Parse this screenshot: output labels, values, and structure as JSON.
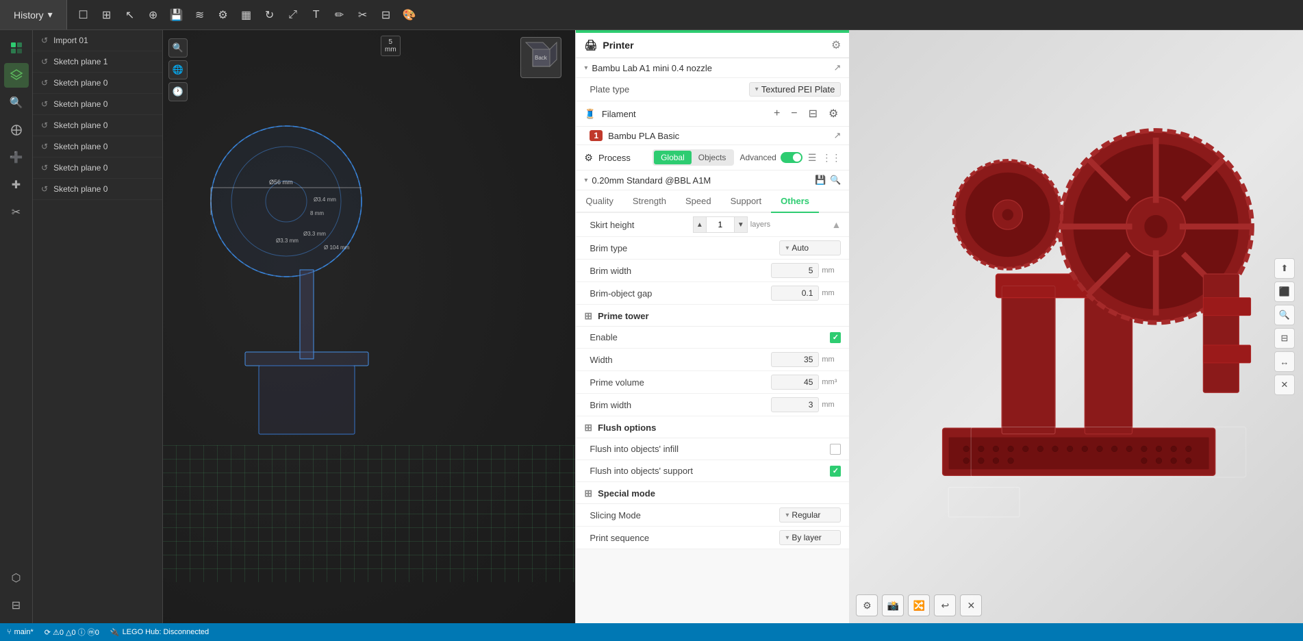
{
  "toolbar": {
    "history_label": "History",
    "history_dropdown_icon": "▾"
  },
  "history_panel": {
    "items": [
      {
        "label": "Import 01",
        "icon": "↺"
      },
      {
        "label": "Sketch plane 1",
        "icon": "↺"
      },
      {
        "label": "Sketch plane 0",
        "icon": "↺"
      },
      {
        "label": "Sketch plane 0",
        "icon": "↺"
      },
      {
        "label": "Sketch plane 0",
        "icon": "↺"
      },
      {
        "label": "Sketch plane 0",
        "icon": "↺"
      },
      {
        "label": "Sketch plane 0",
        "icon": "↺"
      },
      {
        "label": "Sketch plane 0",
        "icon": "↺"
      }
    ]
  },
  "settings": {
    "printer_label": "Printer",
    "printer_icon": "🖨",
    "model_name": "Bambu Lab A1 mini 0.4 nozzle",
    "plate_type_label": "Plate type",
    "plate_value": "Textured PEI Plate",
    "filament_label": "Filament",
    "filament_add": "+",
    "filament_remove": "−",
    "filament_item_num": "1",
    "filament_name": "Bambu PLA Basic",
    "process_label": "Process",
    "tab_global": "Global",
    "tab_objects": "Objects",
    "advanced_label": "Advanced",
    "profile_name": "0.20mm Standard @BBL A1M",
    "tabs": [
      "Quality",
      "Strength",
      "Speed",
      "Support",
      "Others"
    ],
    "active_tab": "Others",
    "skirt_height_label": "Skirt height",
    "skirt_height_value": "1",
    "skirt_height_unit": "layers",
    "brim_type_label": "Brim type",
    "brim_type_value": "Auto",
    "brim_width_label": "Brim width",
    "brim_width_value": "5",
    "brim_width_unit": "mm",
    "brim_object_gap_label": "Brim-object gap",
    "brim_object_gap_value": "0.1",
    "brim_object_gap_unit": "mm",
    "prime_tower_section": "Prime tower",
    "enable_label": "Enable",
    "enable_checked": true,
    "width_label": "Width",
    "width_value": "35",
    "width_unit": "mm",
    "prime_volume_label": "Prime volume",
    "prime_volume_value": "45",
    "prime_volume_unit": "mm³",
    "prime_brim_width_label": "Brim width",
    "prime_brim_width_value": "3",
    "prime_brim_width_unit": "mm",
    "flush_options_section": "Flush options",
    "flush_infill_label": "Flush into objects' infill",
    "flush_infill_checked": false,
    "flush_support_label": "Flush into objects' support",
    "flush_support_checked": true,
    "special_mode_section": "Special mode",
    "slicing_mode_label": "Slicing Mode",
    "slicing_mode_value": "Regular",
    "print_seq_label": "Print sequence",
    "print_seq_value": "By layer"
  },
  "status_bar": {
    "branch": "main*",
    "icons_row": "⟳  ⚠0 △0  ⓘ  ⓜ0",
    "hub_status": "LEGO Hub: Disconnected"
  },
  "left_sidebar": {
    "icons": [
      "⊕",
      "⊞",
      "≋",
      "✱",
      "✂",
      "⬡",
      "⊟"
    ]
  },
  "mm_label": "5\nmm"
}
